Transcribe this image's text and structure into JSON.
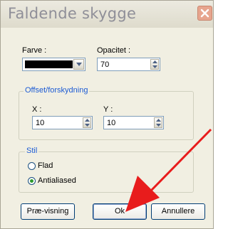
{
  "dialog": {
    "title": "Faldende skygge"
  },
  "color": {
    "label": "Farve :",
    "value_color": "#000000"
  },
  "opacity": {
    "label": "Opacitet :",
    "value": "70"
  },
  "offset": {
    "group_title": "Offset/forskydning",
    "x_label": "X :",
    "x_value": "10",
    "y_label": "Y :",
    "y_value": "10"
  },
  "style": {
    "group_title": "Stil",
    "options": [
      {
        "label": "Flad",
        "selected": false
      },
      {
        "label": "Antialiased",
        "selected": true
      }
    ]
  },
  "buttons": {
    "preview": "Præ-visning",
    "ok": "Ok",
    "cancel": "Annullere"
  },
  "colors": {
    "annotation_arrow": "#e81c1c",
    "group_title": "#1c5bd4"
  },
  "icons": [
    "close-icon",
    "dropdown-arrow-icon",
    "spin-up-icon",
    "spin-down-icon",
    "annotation-arrow"
  ]
}
